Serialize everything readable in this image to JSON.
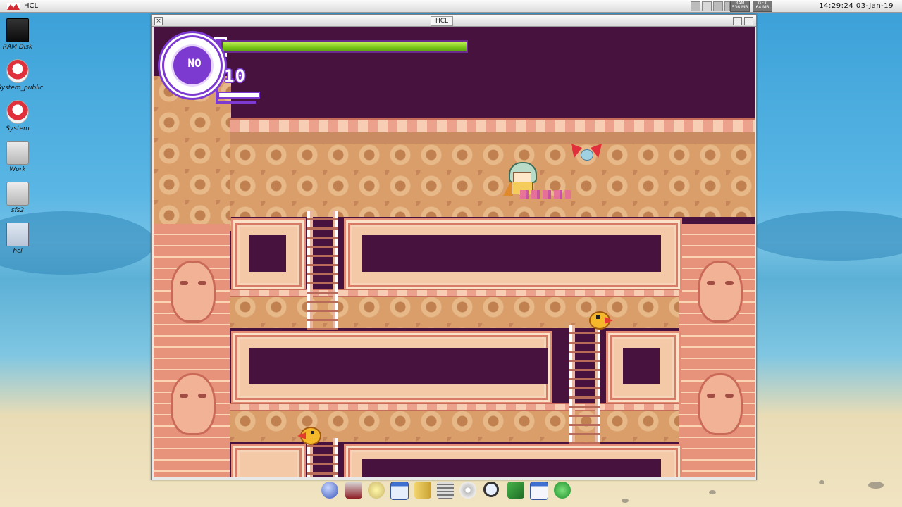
{
  "menubar": {
    "app_title": "HCL",
    "ram_meter_label": "RAM",
    "ram_meter_value": "536 MB",
    "gfx_meter_label": "GFX",
    "gfx_meter_value": "64 MB",
    "clock": "14:29:24  03-Jan-19"
  },
  "desktop": {
    "icons": [
      {
        "label": "RAM Disk",
        "icon": "ramdisk-icon"
      },
      {
        "label": "System_public",
        "icon": "disk-icon"
      },
      {
        "label": "System",
        "icon": "disk-icon"
      },
      {
        "label": "Work",
        "icon": "drawer-icon"
      },
      {
        "label": "sfs2",
        "icon": "drawer-icon"
      },
      {
        "label": "hcl",
        "icon": "document-icon"
      }
    ]
  },
  "window": {
    "title": "HCL",
    "close_glyph": "×"
  },
  "game": {
    "weapon_label": "NO",
    "count": "10",
    "health_fraction": 1.0
  },
  "dock": {
    "items": [
      "ball-icon",
      "viewer-icon",
      "prefs-icon",
      "window-icon",
      "files-icon",
      "notes-icon",
      "disc-icon",
      "search-icon",
      "editor-icon",
      "calendar-icon",
      "download-icon"
    ]
  },
  "colors": {
    "hud_purple": "#7d3ad0",
    "health_green": "#79c518",
    "game_void": "#48123f"
  }
}
